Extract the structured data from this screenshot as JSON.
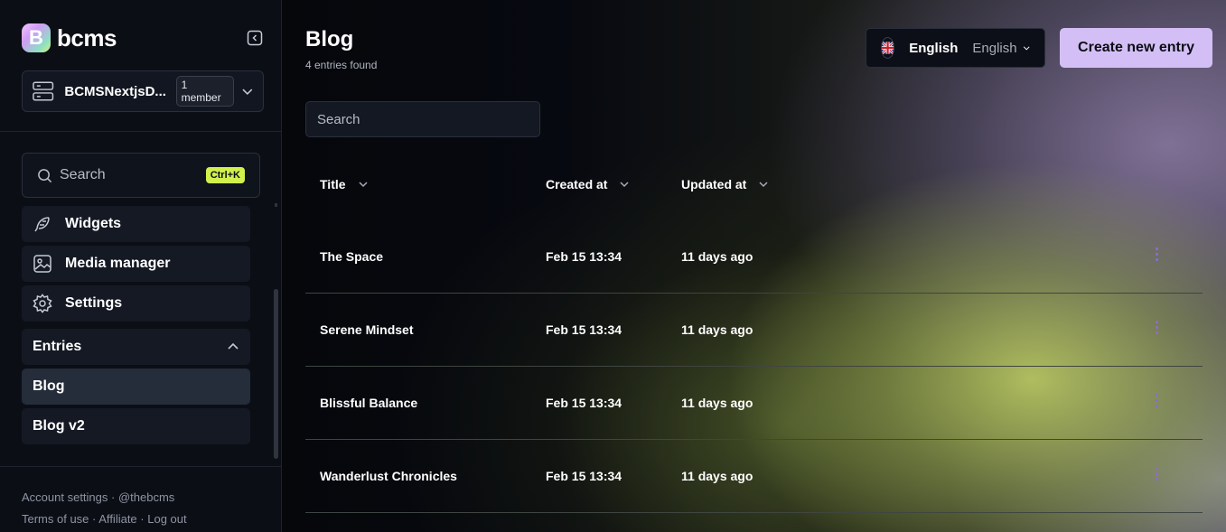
{
  "app": {
    "logo_letter": "B",
    "logo_text": "bcms"
  },
  "project": {
    "name": "BCMSNextjsD...",
    "members": "1 member"
  },
  "sidebar": {
    "search_label": "Search",
    "search_shortcut": "Ctrl+K",
    "items": [
      {
        "label": "Widgets",
        "icon": "feather-icon"
      },
      {
        "label": "Media manager",
        "icon": "image-icon"
      },
      {
        "label": "Settings",
        "icon": "gear-icon"
      }
    ],
    "entries_section": {
      "label": "Entries",
      "items": [
        "Blog",
        "Blog v2"
      ],
      "active": "Blog"
    },
    "footer": {
      "account_settings": "Account settings",
      "handle": "@thebcms",
      "terms": "Terms of use",
      "affiliate": "Affiliate",
      "logout": "Log out",
      "separator": " · "
    }
  },
  "main": {
    "title": "Blog",
    "count": "4 entries found",
    "language": {
      "name": "English",
      "selected": "English"
    },
    "create_button": "Create new entry",
    "search_placeholder": "Search",
    "columns": [
      "Title",
      "Created at",
      "Updated at"
    ],
    "rows": [
      {
        "title": "The Space",
        "created": "Feb 15 13:34",
        "updated": "11 days ago"
      },
      {
        "title": "Serene Mindset",
        "created": "Feb 15 13:34",
        "updated": "11 days ago"
      },
      {
        "title": "Blissful Balance",
        "created": "Feb 15 13:34",
        "updated": "11 days ago"
      },
      {
        "title": "Wanderlust Chronicles",
        "created": "Feb 15 13:34",
        "updated": "11 days ago"
      }
    ]
  },
  "colors": {
    "accent": "#d3bff5",
    "shortcut_badge": "#d2f04c",
    "row_menu": "#8d6bd8",
    "sidebar_bg": "#0b0e15"
  }
}
